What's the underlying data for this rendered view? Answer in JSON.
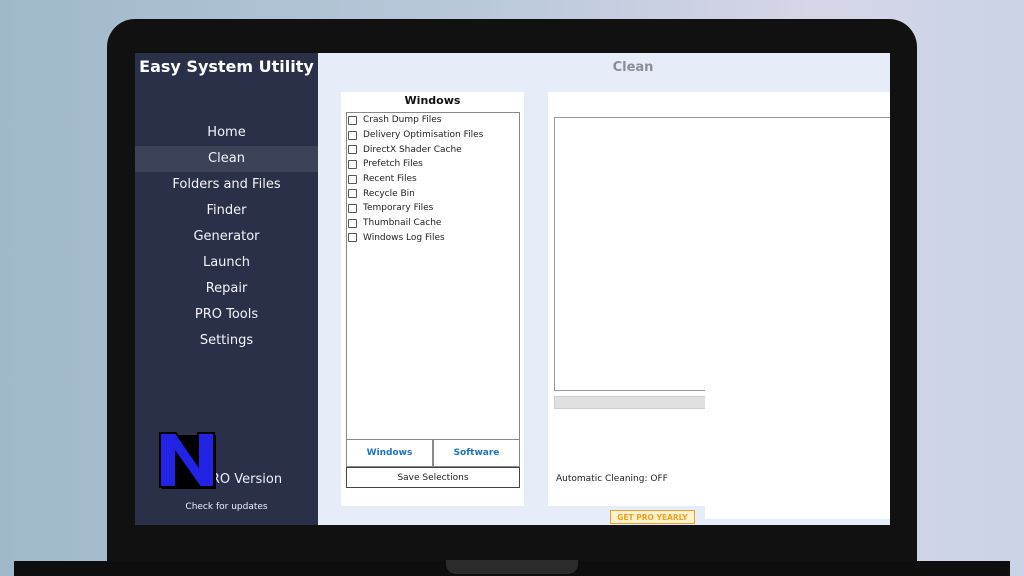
{
  "app": {
    "title": "Easy System Utility"
  },
  "sidebar": {
    "items": [
      {
        "label": "Home"
      },
      {
        "label": "Clean"
      },
      {
        "label": "Folders and Files"
      },
      {
        "label": "Finder"
      },
      {
        "label": "Generator"
      },
      {
        "label": "Launch"
      },
      {
        "label": "Repair"
      },
      {
        "label": "PRO Tools"
      },
      {
        "label": "Settings"
      }
    ],
    "active": "Clean",
    "pro_version": "RO Version",
    "check_updates": "Check for updates"
  },
  "main": {
    "title": "Clean",
    "windows_panel": {
      "heading": "Windows",
      "items": [
        "Crash Dump Files",
        "Delivery Optimisation Files",
        "DirectX Shader Cache",
        "Prefetch Files",
        "Recent Files",
        "Recycle Bin",
        "Temporary Files",
        "Thumbnail Cache",
        "Windows Log Files"
      ],
      "tabs": [
        "Windows",
        "Software"
      ],
      "save_label": "Save Selections"
    },
    "automatic_cleaning": "Automatic Cleaning: OFF",
    "pro_yearly": "GET PRO YEARLY"
  },
  "colors": {
    "sidebar": "#2b3049",
    "active_nav": "#3c4257",
    "link_blue": "#1a73c4",
    "pro_orange": "#f0a020",
    "logo_blue": "#2323e6"
  }
}
